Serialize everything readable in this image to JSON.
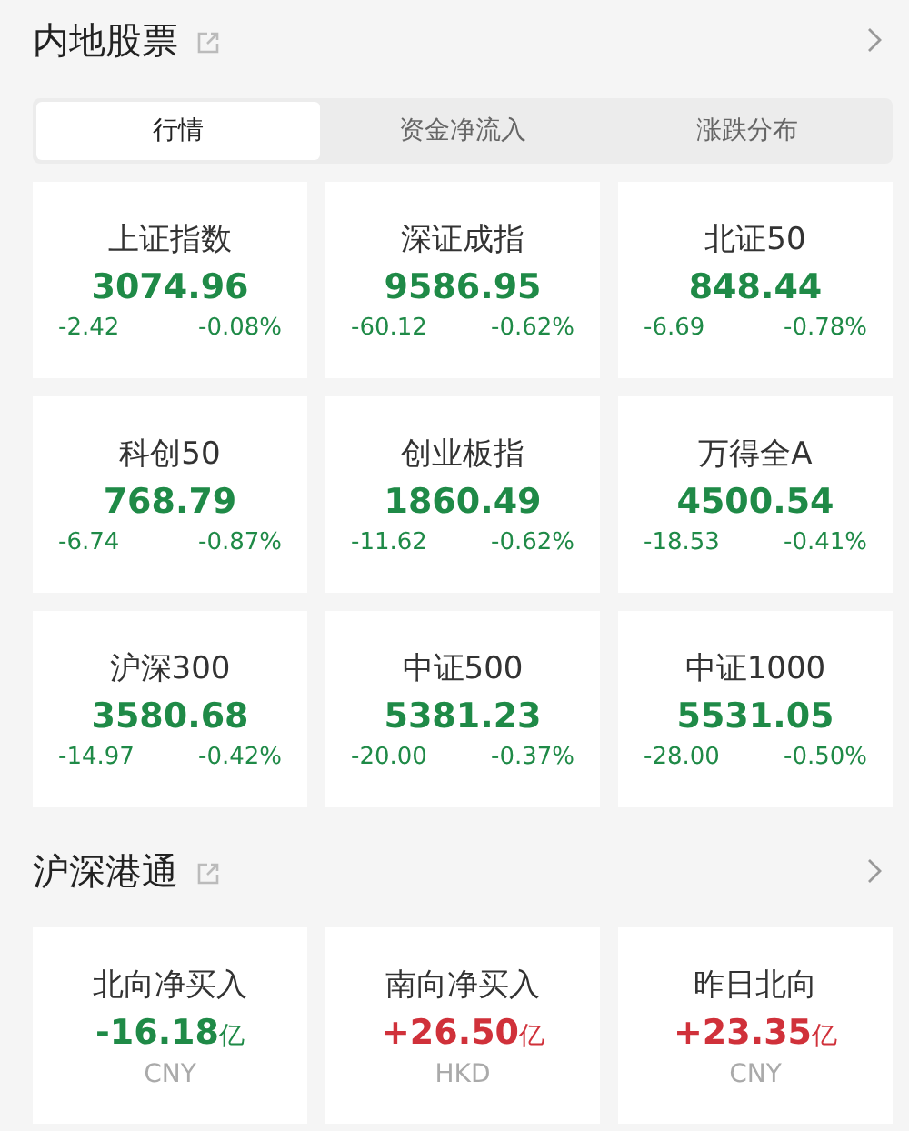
{
  "sections": [
    {
      "title": "内地股票",
      "tabs": [
        {
          "label": "行情",
          "selected": true
        },
        {
          "label": "资金净流入",
          "selected": false
        },
        {
          "label": "涨跌分布",
          "selected": false
        }
      ],
      "cards": [
        {
          "kind": "index",
          "name": "上证指数",
          "value": "3074.96",
          "color": "#1f8a47",
          "change": "-2.42",
          "percent": "-0.08%"
        },
        {
          "kind": "index",
          "name": "深证成指",
          "value": "9586.95",
          "color": "#1f8a47",
          "change": "-60.12",
          "percent": "-0.62%"
        },
        {
          "kind": "index",
          "name": "北证50",
          "value": "848.44",
          "color": "#1f8a47",
          "change": "-6.69",
          "percent": "-0.78%"
        },
        {
          "kind": "index",
          "name": "科创50",
          "value": "768.79",
          "color": "#1f8a47",
          "change": "-6.74",
          "percent": "-0.87%"
        },
        {
          "kind": "index",
          "name": "创业板指",
          "value": "1860.49",
          "color": "#1f8a47",
          "change": "-11.62",
          "percent": "-0.62%"
        },
        {
          "kind": "index",
          "name": "万得全A",
          "value": "4500.54",
          "color": "#1f8a47",
          "change": "-18.53",
          "percent": "-0.41%"
        },
        {
          "kind": "index",
          "name": "沪深300",
          "value": "3580.68",
          "color": "#1f8a47",
          "change": "-14.97",
          "percent": "-0.42%"
        },
        {
          "kind": "index",
          "name": "中证500",
          "value": "5381.23",
          "color": "#1f8a47",
          "change": "-20.00",
          "percent": "-0.37%"
        },
        {
          "kind": "index",
          "name": "中证1000",
          "value": "5531.05",
          "color": "#1f8a47",
          "change": "-28.00",
          "percent": "-0.50%"
        }
      ]
    },
    {
      "title": "沪深港通",
      "cards": [
        {
          "kind": "flow",
          "name": "北向净买入",
          "value": "-16.18",
          "unit": "亿",
          "color": "#1f8a47",
          "currency": "CNY"
        },
        {
          "kind": "flow",
          "name": "南向净买入",
          "value": "+26.50",
          "unit": "亿",
          "color": "#d0313a",
          "currency": "HKD"
        },
        {
          "kind": "flow",
          "name": "昨日北向",
          "value": "+23.35",
          "unit": "亿",
          "color": "#d0313a",
          "currency": "CNY"
        }
      ]
    }
  ]
}
